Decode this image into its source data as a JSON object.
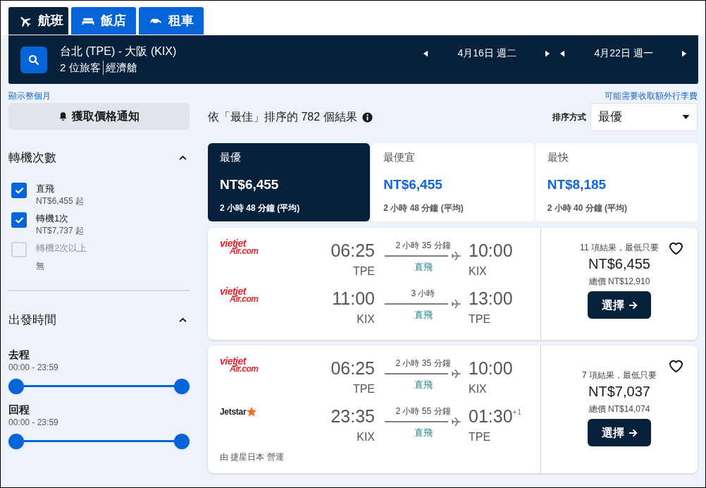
{
  "tabs": [
    {
      "kind": "plane",
      "label": "航班",
      "selected": true
    },
    {
      "kind": "bed",
      "label": "飯店",
      "selected": false
    },
    {
      "kind": "car",
      "label": "租車",
      "selected": false
    }
  ],
  "search": {
    "route": "台北 (TPE) - 大阪 (KIX)",
    "travelers": "2 位旅客",
    "cabin": "經濟艙",
    "dates": [
      {
        "label": "4月16日 週二"
      },
      {
        "label": "4月22日 週一"
      }
    ]
  },
  "links": {
    "month": "顯示整個月",
    "baggage": "可能需要收取額外行李費"
  },
  "price_alert": "獲取價格通知",
  "filters": {
    "stops": {
      "title": "轉機次數",
      "expanded": true,
      "options": [
        {
          "label": "直飛",
          "price": "NT$6,455 起",
          "checked": true,
          "disabled": false
        },
        {
          "label": "轉機1次",
          "price": "NT$7,737 起",
          "checked": true,
          "disabled": false
        },
        {
          "label": "轉機2次以上",
          "price": "無",
          "checked": false,
          "disabled": true
        }
      ]
    },
    "departure_time": {
      "title": "出發時間",
      "expanded": true,
      "ranges": [
        {
          "label": "去程",
          "range": "00:00 - 23:59",
          "level": 1
        },
        {
          "label": "回程",
          "range": "00:00 - 23:59",
          "level": 1
        }
      ]
    }
  },
  "results_summary": "依「最佳」排序的 782 個結果",
  "sort": {
    "label": "排序方式",
    "value": "最優"
  },
  "sort_tabs": [
    {
      "label": "最優",
      "price": "NT$6,455",
      "duration": "2 小時 48 分鐘 (平均)",
      "selected": true
    },
    {
      "label": "最便宜",
      "price": "NT$6,455",
      "duration": "2 小時 48 分鐘 (平均)",
      "selected": false
    },
    {
      "label": "最快",
      "price": "NT$8,185",
      "duration": "2 小時 40 分鐘 (平均)",
      "selected": false
    }
  ],
  "results": [
    {
      "legs": [
        {
          "airline": {
            "kind": "vietjet",
            "line_1": "vietjet",
            "line_2": "Air.com"
          },
          "depart_time": "06:25",
          "depart_airport": "TPE",
          "duration": "2 小時 35 分鐘",
          "stops": "直飛",
          "arrive_time": "10:00",
          "arrive_airport": "KIX"
        },
        {
          "airline": {
            "kind": "vietjet",
            "line_1": "vietjet",
            "line_2": "Air.com"
          },
          "depart_time": "11:00",
          "depart_airport": "KIX",
          "duration": "3 小時",
          "stops": "直飛",
          "arrive_time": "13:00",
          "arrive_airport": "TPE"
        }
      ],
      "summary": "11 項結果，最低只要",
      "price": "NT$6,455",
      "total": "總價 NT$12,910",
      "button": "選擇"
    },
    {
      "legs": [
        {
          "airline": {
            "kind": "vietjet",
            "line_1": "vietjet",
            "line_2": "Air.com"
          },
          "depart_time": "06:25",
          "depart_airport": "TPE",
          "duration": "2 小時 35 分鐘",
          "stops": "直飛",
          "arrive_time": "10:00",
          "arrive_airport": "KIX"
        },
        {
          "airline": {
            "kind": "jetstar",
            "line_1": "Jetstar"
          },
          "depart_time": "23:35",
          "depart_airport": "KIX",
          "duration": "2 小時 55 分鐘",
          "stops": "直飛",
          "arrive_time": "01:30",
          "day_offset": "+1",
          "arrive_airport": "TPE"
        }
      ],
      "operated_by": "由 捷星日本 營運",
      "summary": "7 項結果，最低只要",
      "price": "NT$7,037",
      "total": "總價 NT$14,074",
      "button": "選擇"
    }
  ]
}
